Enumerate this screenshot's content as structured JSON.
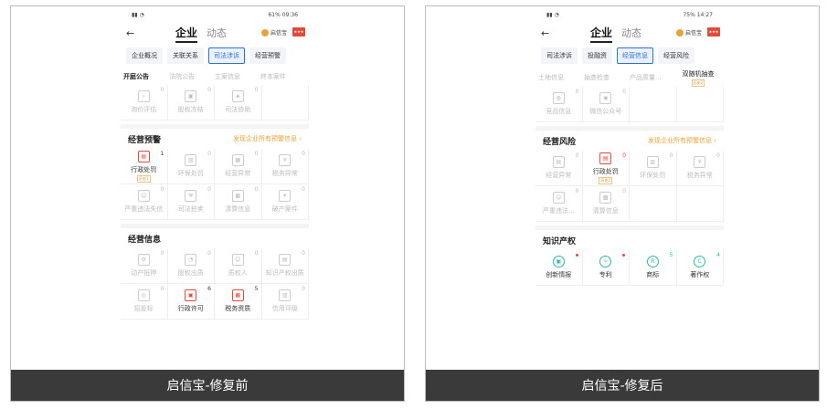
{
  "panels": {
    "before": {
      "status_time": "61% 09:36",
      "chips": [
        "企业概况",
        "关联关系",
        "司法涉诉",
        "经营预警"
      ],
      "text_row": [
        "开庭公告",
        "法院公告",
        "立案信息",
        "终本案件"
      ],
      "grid1": [
        {
          "label": "询价评估",
          "count": "0"
        },
        {
          "label": "股权冻结",
          "count": "0"
        },
        {
          "label": "司法协助",
          "count": "0"
        }
      ],
      "section1": {
        "title": "经营预警",
        "link": "发现企业所有预警信息 ›"
      },
      "grid2": [
        {
          "label": "行政处罚",
          "count": "1",
          "tag": "历史1"
        },
        {
          "label": "环保处罚",
          "count": "0"
        },
        {
          "label": "经营异常",
          "count": "0"
        },
        {
          "label": "税务异常",
          "count": "0"
        },
        {
          "label": "严重违法失信",
          "count": "0"
        },
        {
          "label": "司法拍卖",
          "count": "0"
        },
        {
          "label": "清算信息",
          "count": "0"
        },
        {
          "label": "破产案件",
          "count": "0"
        }
      ],
      "section2": {
        "title": "经营信息"
      },
      "grid3": [
        {
          "label": "动产抵押",
          "count": "0"
        },
        {
          "label": "股权出质",
          "count": "0"
        },
        {
          "label": "质权人",
          "count": "0"
        },
        {
          "label": "知识产权出质",
          "count": "0"
        },
        {
          "label": "招投标",
          "count": "0"
        },
        {
          "label": "行政许可",
          "count": "6"
        },
        {
          "label": "税务资质",
          "count": "5"
        },
        {
          "label": "信用评级",
          "count": "0"
        }
      ],
      "caption": "启信宝-修复前"
    },
    "after": {
      "status_time": "75% 14:27",
      "chips": [
        "司法涉诉",
        "投融资",
        "经营信息",
        "经营风险"
      ],
      "text_row": [
        "土地信息",
        "抽查检查",
        "产品质量...",
        "双随机抽查"
      ],
      "text_tag": "历史2",
      "grid1": [
        {
          "label": "竞品信息",
          "count": "0"
        },
        {
          "label": "微信公众号",
          "count": "0"
        }
      ],
      "section1": {
        "title": "经营风险",
        "link": "发现企业所有预警信息 ›"
      },
      "grid2": [
        {
          "label": "经营异常",
          "count": "0"
        },
        {
          "label": "行政处罚",
          "count": "0",
          "tag": "历史2"
        },
        {
          "label": "环保处罚",
          "count": "0"
        },
        {
          "label": "税务异常",
          "count": "0"
        },
        {
          "label": "严重违法...",
          "count": "0"
        },
        {
          "label": "清算信息",
          "count": "0"
        }
      ],
      "section2": {
        "title": "知识产权"
      },
      "grid3": [
        {
          "label": "创新情报",
          "count": ""
        },
        {
          "label": "专利",
          "count": ""
        },
        {
          "label": "商标",
          "count": "5"
        },
        {
          "label": "著作权",
          "count": "4"
        }
      ],
      "caption": "启信宝-修复后"
    }
  },
  "nav": {
    "tab_active": "企业",
    "tab": "动态",
    "brand": "启信宝"
  },
  "colors": {
    "accent": "#2f6fd6",
    "warning": "#e8a23a",
    "danger": "#e24a3b",
    "teal": "#2db6a2"
  }
}
